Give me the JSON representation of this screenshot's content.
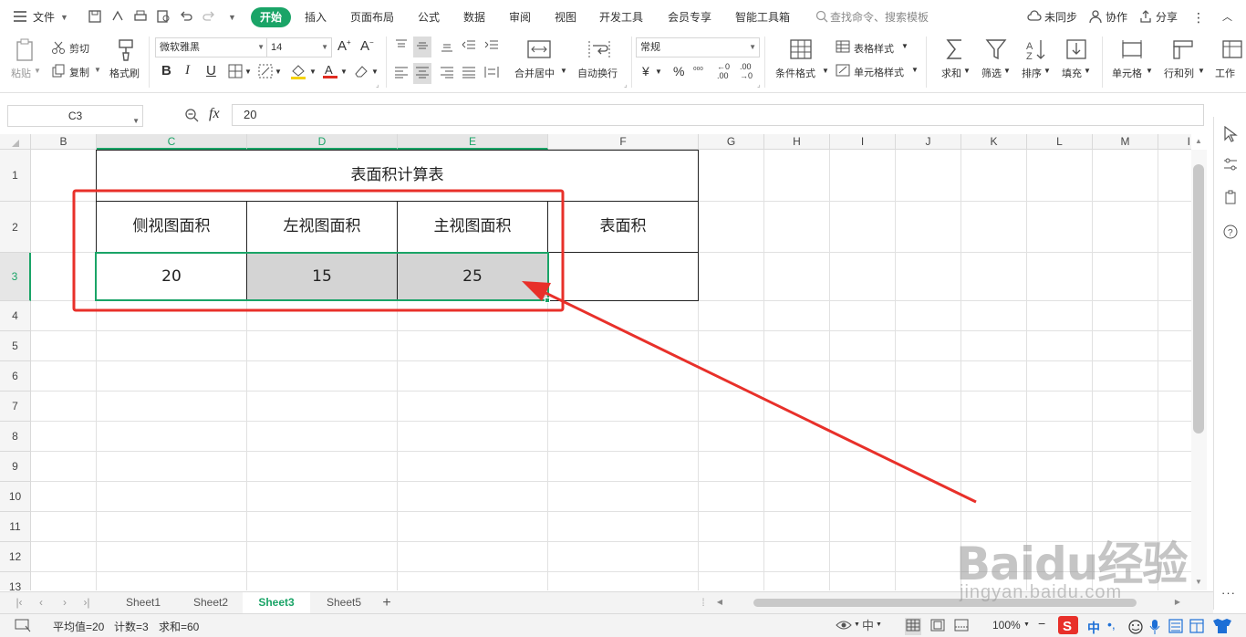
{
  "menubar": {
    "file": "文件",
    "tabs": [
      "开始",
      "插入",
      "页面布局",
      "公式",
      "数据",
      "审阅",
      "视图",
      "开发工具",
      "会员专享",
      "智能工具箱"
    ],
    "search_placeholder": "查找命令、搜索模板",
    "sync": "未同步",
    "collab": "协作",
    "share": "分享"
  },
  "ribbon": {
    "paste": "粘贴",
    "cut": "剪切",
    "copy": "复制",
    "format_painter": "格式刷",
    "font_name": "微软雅黑",
    "font_size": "14",
    "merge_center": "合并居中",
    "wrap_text": "自动换行",
    "number_format": "常规",
    "conditional_format": "条件格式",
    "table_style": "表格样式",
    "cell_style": "单元格样式",
    "sum": "求和",
    "filter": "筛选",
    "sort": "排序",
    "fill": "填充",
    "cells": "单元格",
    "rows_cols": "行和列",
    "worksheet": "工作"
  },
  "formula_bar": {
    "name_box": "C3",
    "fx": "fx",
    "formula": "20"
  },
  "grid": {
    "columns": [
      "B",
      "C",
      "D",
      "E",
      "F",
      "G",
      "H",
      "I",
      "J",
      "K",
      "L",
      "M",
      "I"
    ],
    "rows": [
      "1",
      "2",
      "3",
      "4",
      "5",
      "6",
      "7",
      "8",
      "9",
      "10",
      "11",
      "12",
      "13"
    ],
    "table_title": "表面积计算表",
    "headers": [
      "侧视图面积",
      "左视图面积",
      "主视图面积",
      "表面积"
    ],
    "values": [
      "20",
      "15",
      "25",
      ""
    ]
  },
  "sheets": {
    "tabs": [
      "Sheet1",
      "Sheet2",
      "Sheet3",
      "Sheet5"
    ],
    "active": "Sheet3"
  },
  "status": {
    "average": "平均值=20",
    "count": "计数=3",
    "sum": "求和=60",
    "zoom": "100%"
  },
  "ime": {
    "lang": "中"
  },
  "watermark": {
    "brand": "Baidu经验",
    "url": "jingyan.baidu.com"
  },
  "colors": {
    "accent": "#1aa467",
    "annotation": "#e8302a",
    "selected_fill": "#d4d4d4"
  }
}
